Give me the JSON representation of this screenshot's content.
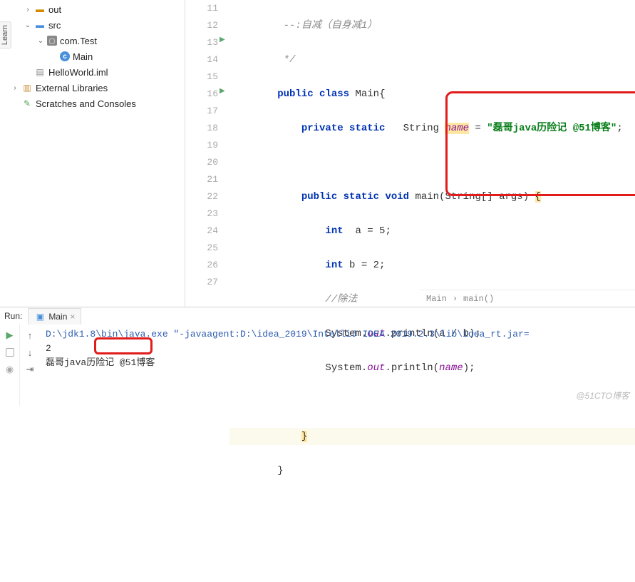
{
  "sidebar": {
    "learn": "Learn",
    "items": [
      {
        "label": "out"
      },
      {
        "label": "src"
      },
      {
        "label": "com.Test"
      },
      {
        "label": "Main"
      },
      {
        "label": "HelloWorld.iml"
      },
      {
        "label": "External Libraries"
      },
      {
        "label": "Scratches and Consoles"
      }
    ]
  },
  "gutter": [
    "11",
    "12",
    "13",
    "14",
    "15",
    "16",
    "17",
    "18",
    "19",
    "20",
    "21",
    "22",
    "23",
    "24",
    "25",
    "26",
    "27"
  ],
  "code": {
    "l11": "--:自减（自身减1）",
    "l12": "*/",
    "l13a": "public",
    "l13b": " class",
    "l13c": " Main{",
    "l14a": "private static",
    "l14b": "   String ",
    "l14c": "name",
    "l14d": " = ",
    "l14e": "\"磊哥java历险记 @51博客\"",
    "l14f": ";",
    "l16a": "public static void",
    "l16b": " main(String[] args) ",
    "l16c": "{",
    "l17a": "int",
    "l17b": "  a = 5;",
    "l18a": "int",
    "l18b": " b = 2;",
    "l19": "//除法",
    "l20a": "System.",
    "l20b": "out",
    "l20c": ".println(a / b);",
    "l21a": "System.",
    "l21b": "out",
    "l21c": ".println(",
    "l21d": "name",
    "l21e": ");",
    "l23": "}",
    "l24": "}"
  },
  "breadcrumb": {
    "a": "Main",
    "b": "main()"
  },
  "run": {
    "label": "Run:",
    "tab": "Main",
    "cmd": "D:\\jdk1.8\\bin\\java.exe \"-javaagent:D:\\idea_2019\\IntelliJ IDEA 2019.2.3\\lib\\idea_rt.jar=",
    "out1": "2",
    "out2": "磊哥java历险记 @51博客"
  },
  "watermark": "@51CTO博客"
}
